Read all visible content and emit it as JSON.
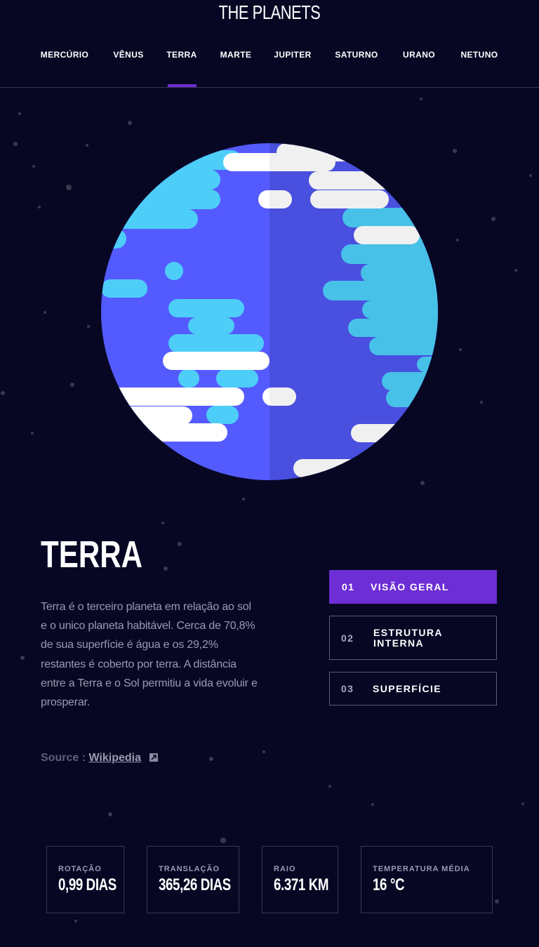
{
  "app": {
    "logo": "THE PLANETS"
  },
  "nav": {
    "items": [
      "MERCÚRIO",
      "VÊNUS",
      "TERRA",
      "MARTE",
      "JUPITER",
      "SATURNO",
      "URANO",
      "NETUNO"
    ],
    "active": "TERRA"
  },
  "planet": {
    "name": "TERRA",
    "description": "Terra é o terceiro planeta em relação ao sol e o unico planeta habitável. Cerca de 70,8% de sua superfície é água e os 29,2% restantes é coberto por terra. A distância entre a Terra e o Sol permitiu a vida evoluir e prosperar.",
    "source_label": "Source : ",
    "source_link": "Wikipedia",
    "image_icon": "earth-illustration"
  },
  "tabs": [
    {
      "num": "01",
      "label": "VISÃO GERAL",
      "active": true
    },
    {
      "num": "02",
      "label": "ESTRUTURA INTERNA",
      "active": false
    },
    {
      "num": "03",
      "label": "SUPERFÍCIE",
      "active": false
    }
  ],
  "stats": [
    {
      "label": "ROTAÇÃO",
      "value": "0,99 DIAS"
    },
    {
      "label": "TRANSLAÇÃO",
      "value": "365,26 DIAS"
    },
    {
      "label": "RAIO",
      "value": "6.371 KM"
    },
    {
      "label": "TEMPERATURA MÉDIA",
      "value": "16 °C"
    }
  ],
  "colors": {
    "background": "#070724",
    "accent": "#6d2ed5",
    "ocean": "#545bfe",
    "land": "#4dcef8",
    "clouds": "#ffffff"
  }
}
